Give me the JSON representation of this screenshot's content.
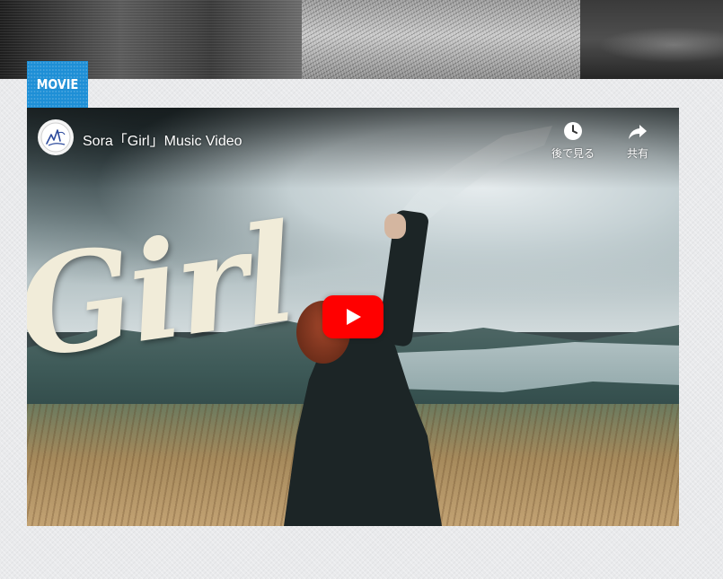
{
  "section": {
    "label": "MOVIE",
    "accent_color": "#1e8fd6"
  },
  "video": {
    "title": "Sora「Girl」Music Video",
    "title_art": "Girl",
    "controls": {
      "watch_later_label": "後で見る",
      "watch_later_icon": "clock-icon",
      "share_label": "共有",
      "share_icon": "share-arrow-icon"
    },
    "play_button": {
      "icon": "play-icon",
      "color": "#ff0000"
    }
  }
}
